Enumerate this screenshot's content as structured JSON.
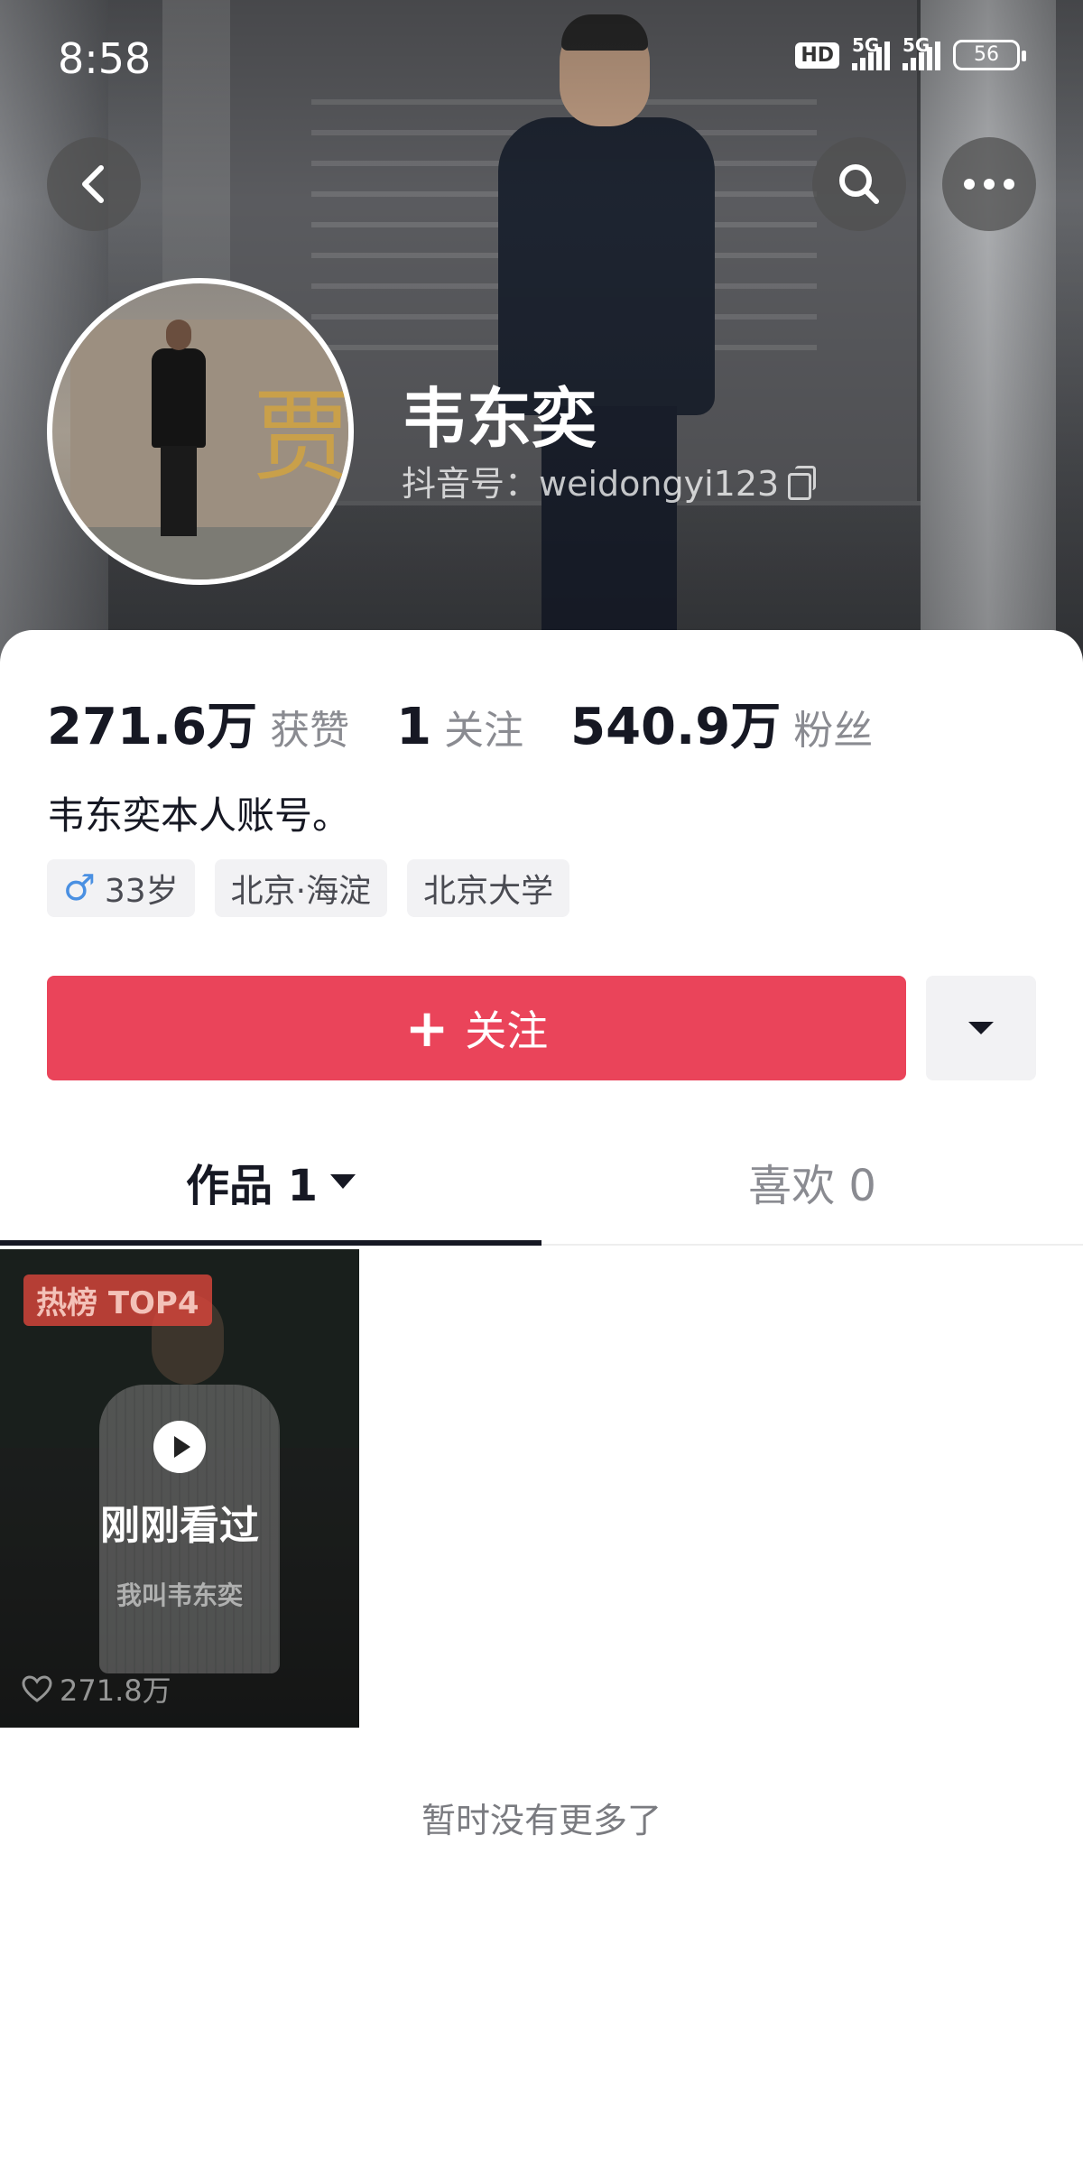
{
  "status_bar": {
    "time": "8:58",
    "hd_label": "HD",
    "network_1": "5G",
    "network_2": "5G",
    "battery": "56"
  },
  "profile": {
    "name": "韦东奕",
    "account_id": "抖音号：weidongyi123",
    "bio": "韦东奕本人账号。"
  },
  "stats": {
    "likes_value": "271.6万",
    "likes_label": "获赞",
    "following_value": "1",
    "following_label": "关注",
    "followers_value": "540.9万",
    "followers_label": "粉丝"
  },
  "tags": {
    "age": "33岁",
    "location": "北京·海淀",
    "school": "北京大学"
  },
  "actions": {
    "follow_plus": "+",
    "follow_label": "关注"
  },
  "tabs": {
    "works": "作品 1",
    "likes": "喜欢 0"
  },
  "video": {
    "badge": "热榜 TOP4",
    "seen_label": "刚刚看过",
    "caption": "我叫韦东奕",
    "like_count": "271.8万"
  },
  "footer": {
    "no_more": "暂时没有更多了"
  },
  "colors": {
    "accent": "#ea445a",
    "text_primary": "#161823",
    "text_secondary": "#8a8b91"
  }
}
